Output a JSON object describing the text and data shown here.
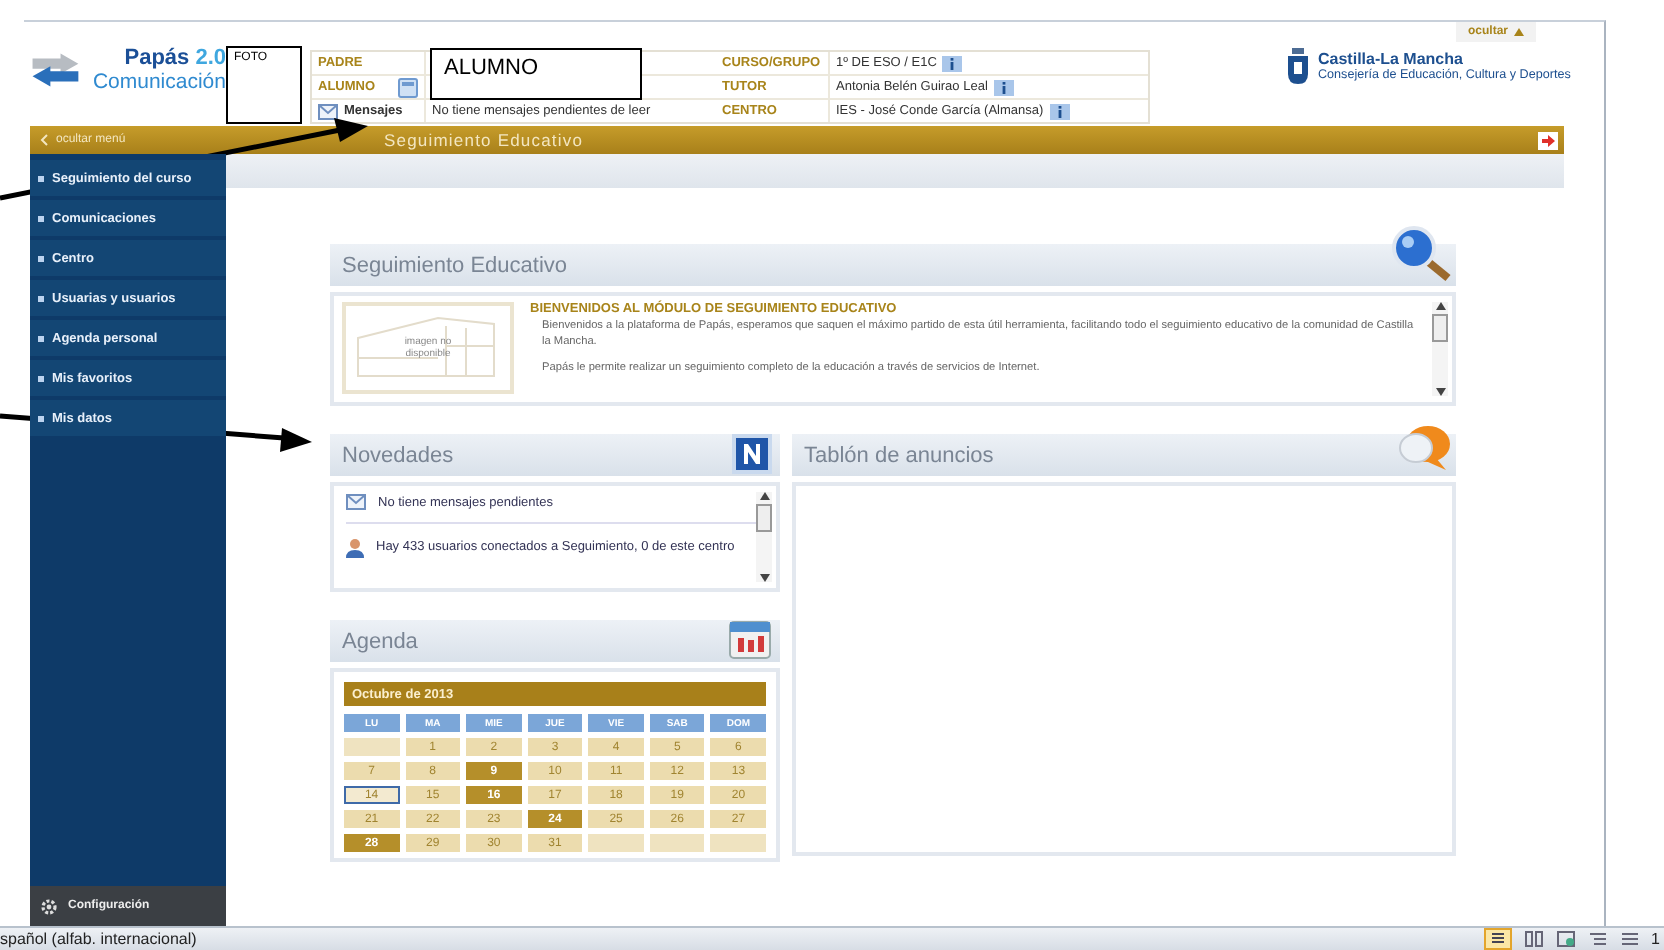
{
  "header": {
    "hide_tab": "ocultar",
    "logo": {
      "title": "Papás",
      "version": "2.0",
      "subtitle": "Comunicación"
    },
    "info_left": [
      {
        "label": "PADRE",
        "kind": "plain"
      },
      {
        "label": "ALUMNO",
        "kind": "student"
      },
      {
        "label": "Mensajes",
        "kind": "messages",
        "value": "No tiene mensajes pendientes de leer"
      }
    ],
    "info_right": [
      {
        "label": "CURSO/GRUPO",
        "value": "1º DE ESO / E1C"
      },
      {
        "label": "TUTOR",
        "value": "Antonia Belén Guirao Leal"
      },
      {
        "label": "CENTRO",
        "value": "IES - José Conde García (Almansa)"
      }
    ],
    "org": {
      "name": "Castilla-La Mancha",
      "department": "Consejería de Educación, Cultura y Deportes"
    }
  },
  "annotations": {
    "photo_box": "FOTO",
    "student_box": "ALUMNO"
  },
  "menu_bar": {
    "hide_menu": "ocultar menú",
    "title": "Seguimiento Educativo"
  },
  "sidebar": {
    "items": [
      "Seguimiento del curso",
      "Comunicaciones",
      "Centro",
      "Usuarias y usuarios",
      "Agenda personal",
      "Mis favoritos",
      "Mis datos"
    ],
    "settings": "Configuración"
  },
  "welcome": {
    "title": "Seguimiento Educativo",
    "image_text": "imagen no disponible",
    "heading": "BIENVENIDOS AL MÓDULO DE SEGUIMIENTO EDUCATIVO",
    "paragraphs": [
      "Bienvenidos a la plataforma de Papás, esperamos que saquen el máximo partido de esta útil herramienta, facilitando todo el seguimiento educativo de la comunidad de Castilla la Mancha.",
      "Papás le permite realizar un seguimiento completo de la educación a través de servicios de Internet."
    ]
  },
  "news": {
    "title": "Novedades",
    "items": [
      {
        "kind": "message",
        "text": "No tiene mensajes pendientes"
      },
      {
        "kind": "users",
        "text": "Hay 433 usuarios conectados a Seguimiento, 0 de este centro"
      }
    ]
  },
  "board": {
    "title": "Tablón de anuncios"
  },
  "agenda": {
    "title": "Agenda",
    "month": "Octubre de 2013",
    "weekdays": [
      "LU",
      "MA",
      "MIE",
      "JUE",
      "VIE",
      "SAB",
      "DOM"
    ],
    "weeks": [
      [
        {
          "kind": "blank"
        },
        {
          "day": "1",
          "kind": "day"
        },
        {
          "day": "2",
          "kind": "day"
        },
        {
          "day": "3",
          "kind": "day"
        },
        {
          "day": "4",
          "kind": "day"
        },
        {
          "day": "5",
          "kind": "day"
        },
        {
          "day": "6",
          "kind": "day"
        }
      ],
      [
        {
          "day": "7",
          "kind": "day"
        },
        {
          "day": "8",
          "kind": "day"
        },
        {
          "day": "9",
          "kind": "event"
        },
        {
          "day": "10",
          "kind": "day"
        },
        {
          "day": "11",
          "kind": "day"
        },
        {
          "day": "12",
          "kind": "day"
        },
        {
          "day": "13",
          "kind": "day"
        }
      ],
      [
        {
          "day": "14",
          "kind": "today"
        },
        {
          "day": "15",
          "kind": "day"
        },
        {
          "day": "16",
          "kind": "event"
        },
        {
          "day": "17",
          "kind": "day"
        },
        {
          "day": "18",
          "kind": "day"
        },
        {
          "day": "19",
          "kind": "day"
        },
        {
          "day": "20",
          "kind": "day"
        }
      ],
      [
        {
          "day": "21",
          "kind": "day"
        },
        {
          "day": "22",
          "kind": "day"
        },
        {
          "day": "23",
          "kind": "day"
        },
        {
          "day": "24",
          "kind": "event"
        },
        {
          "day": "25",
          "kind": "day"
        },
        {
          "day": "26",
          "kind": "day"
        },
        {
          "day": "27",
          "kind": "day"
        }
      ],
      [
        {
          "day": "28",
          "kind": "event"
        },
        {
          "day": "29",
          "kind": "day"
        },
        {
          "day": "30",
          "kind": "day"
        },
        {
          "day": "31",
          "kind": "day"
        },
        {
          "kind": "blank"
        },
        {
          "kind": "blank"
        },
        {
          "kind": "blank"
        }
      ]
    ]
  },
  "status_bar": {
    "language": "spañol (alfab. internacional)",
    "page": "1"
  }
}
